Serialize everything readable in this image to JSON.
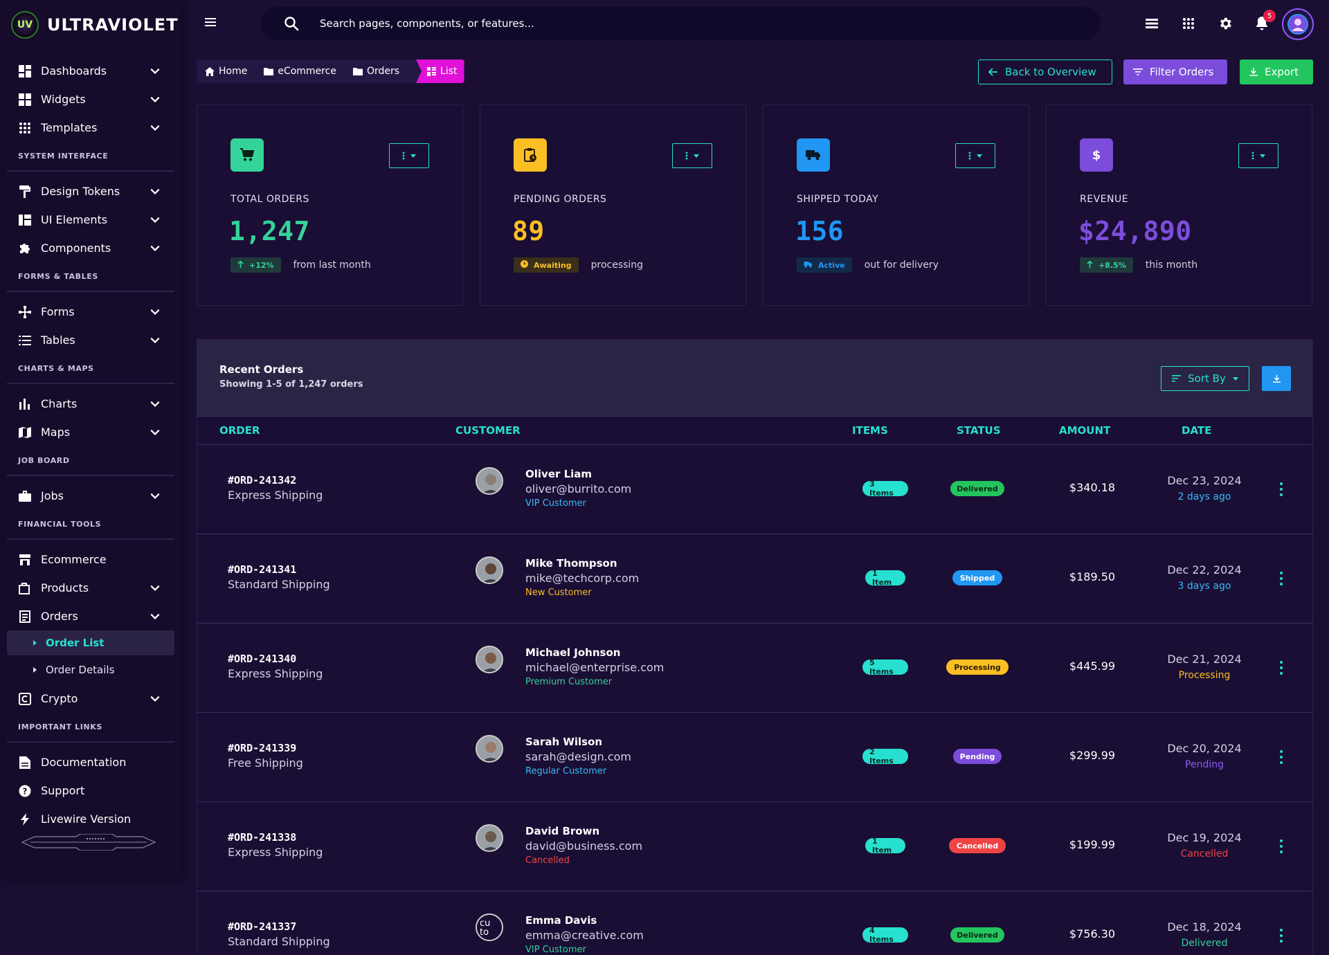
{
  "brand": {
    "logo_text": "UV",
    "name": "ULTRAVIOLET"
  },
  "sidebar": {
    "groups": [
      {
        "items": [
          {
            "label": "Dashboards",
            "icon": "dashboard-icon",
            "has_chevron": true
          },
          {
            "label": "Widgets",
            "icon": "widgets-icon",
            "has_chevron": true
          },
          {
            "label": "Templates",
            "icon": "grid-dots-icon",
            "has_chevron": true
          }
        ]
      },
      {
        "section": "SYSTEM INTERFACE",
        "items": [
          {
            "label": "Design Tokens",
            "icon": "paint-roller-icon",
            "has_chevron": true
          },
          {
            "label": "UI Elements",
            "icon": "ui-elements-icon",
            "has_chevron": true
          },
          {
            "label": "Components",
            "icon": "puzzle-icon",
            "has_chevron": true
          }
        ]
      },
      {
        "section": "FORMS & TABLES",
        "items": [
          {
            "label": "Forms",
            "icon": "forms-icon",
            "has_chevron": true
          },
          {
            "label": "Tables",
            "icon": "tables-icon",
            "has_chevron": true
          }
        ]
      },
      {
        "section": "CHARTS & MAPS",
        "items": [
          {
            "label": "Charts",
            "icon": "bar-chart-icon",
            "has_chevron": true
          },
          {
            "label": "Maps",
            "icon": "map-icon",
            "has_chevron": true
          }
        ]
      },
      {
        "section": "JOB BOARD",
        "items": [
          {
            "label": "Jobs",
            "icon": "briefcase-icon",
            "has_chevron": true
          }
        ]
      },
      {
        "section": "FINANCIAL TOOLS",
        "items": [
          {
            "label": "Ecommerce",
            "icon": "store-icon",
            "has_chevron": false
          },
          {
            "label": "Products",
            "icon": "products-icon",
            "has_chevron": true
          },
          {
            "label": "Orders",
            "icon": "orders-icon",
            "has_chevron": true,
            "children": [
              {
                "label": "Order List",
                "active": true
              },
              {
                "label": "Order Details",
                "active": false
              }
            ]
          },
          {
            "label": "Crypto",
            "icon": "crypto-icon",
            "has_chevron": true
          }
        ]
      },
      {
        "section": "IMPORTANT LINKS",
        "items": [
          {
            "label": "Documentation",
            "icon": "document-icon",
            "has_chevron": false
          },
          {
            "label": "Support",
            "icon": "help-icon",
            "has_chevron": false
          },
          {
            "label": "Livewire Version",
            "icon": "bolt-icon",
            "has_chevron": false
          }
        ]
      }
    ]
  },
  "topbar": {
    "search_placeholder": "Search pages, components, or features...",
    "notification_count": "5"
  },
  "breadcrumb": [
    {
      "label": "Home",
      "icon": "home-icon"
    },
    {
      "label": "eCommerce",
      "icon": "folder-icon"
    },
    {
      "label": "Orders",
      "icon": "folder-icon"
    },
    {
      "label": "List",
      "icon": "list-icon",
      "current": true
    }
  ],
  "header_buttons": {
    "back": "Back to Overview",
    "filter": "Filter Orders",
    "export": "Export"
  },
  "stats": [
    {
      "label": "TOTAL ORDERS",
      "value": "1,247",
      "badge": "+12%",
      "badge_icon": "arrow-up-icon",
      "note": "from last month",
      "color": "#34d399",
      "icon": "cart-icon",
      "icon_bg": "#34d399"
    },
    {
      "label": "PENDING ORDERS",
      "value": "89",
      "badge": "Awaiting",
      "badge_icon": "clock-icon",
      "note": "processing",
      "color": "#fbbf24",
      "icon": "clipboard-clock-icon",
      "icon_bg": "#fbbf24"
    },
    {
      "label": "SHIPPED TODAY",
      "value": "156",
      "badge": "Active",
      "badge_icon": "truck-icon",
      "note": "out for delivery",
      "color": "#2196f3",
      "icon": "truck-icon",
      "icon_bg": "#2196f3"
    },
    {
      "label": "REVENUE",
      "value": "$24,890",
      "badge": "+8.5%",
      "badge_icon": "arrow-up-icon",
      "note": "this month",
      "color": "#7c4ddb",
      "icon": "dollar-icon",
      "icon_bg": "#7c4ddb"
    }
  ],
  "orders": {
    "title": "Recent Orders",
    "subtitle": "Showing 1-5 of 1,247 orders",
    "sort_label": "Sort By",
    "columns": [
      "ORDER",
      "CUSTOMER",
      "ITEMS",
      "STATUS",
      "AMOUNT",
      "DATE"
    ],
    "rows": [
      {
        "id": "#ORD-241342",
        "shipping": "Express Shipping",
        "name": "Oliver Liam",
        "email": "oliver@burrito.com",
        "type": "VIP Customer",
        "type_color": "#38bdf8",
        "items": "3 Items",
        "status": "Delivered",
        "status_bg": "#22c55e",
        "status_fg": "#0b2a16",
        "amount": "$340.18",
        "date": "Dec 23, 2024",
        "rel": "2 days ago",
        "rel_color": "#38bdf8",
        "skin": "#8a7f78"
      },
      {
        "id": "#ORD-241341",
        "shipping": "Standard Shipping",
        "name": "Mike Thompson",
        "email": "mike@techcorp.com",
        "type": "New Customer",
        "type_color": "#fbbf24",
        "items": "1 Item",
        "status": "Shipped",
        "status_bg": "#2196f3",
        "status_fg": "#ffffff",
        "amount": "$189.50",
        "date": "Dec 22, 2024",
        "rel": "3 days ago",
        "rel_color": "#38bdf8",
        "skin": "#5e4534"
      },
      {
        "id": "#ORD-241340",
        "shipping": "Express Shipping",
        "name": "Michael Johnson",
        "email": "michael@enterprise.com",
        "type": "Premium Customer",
        "type_color": "#34d399",
        "items": "5 Items",
        "status": "Processing",
        "status_bg": "#fbbf24",
        "status_fg": "#2a1d00",
        "amount": "$445.99",
        "date": "Dec 21, 2024",
        "rel": "Processing",
        "rel_color": "#fbbf24",
        "skin": "#7a5a44"
      },
      {
        "id": "#ORD-241339",
        "shipping": "Free Shipping",
        "name": "Sarah Wilson",
        "email": "sarah@design.com",
        "type": "Regular Customer",
        "type_color": "#38bdf8",
        "items": "2 Items",
        "status": "Pending",
        "status_bg": "#7c4ddb",
        "status_fg": "#ffffff",
        "amount": "$299.99",
        "date": "Dec 20, 2024",
        "rel": "Pending",
        "rel_color": "#8b5cf6",
        "skin": "#9a7b68"
      },
      {
        "id": "#ORD-241338",
        "shipping": "Express Shipping",
        "name": "David Brown",
        "email": "david@business.com",
        "type": "Cancelled",
        "type_color": "#ef4444",
        "items": "1 Item",
        "status": "Cancelled",
        "status_bg": "#ef4444",
        "status_fg": "#ffffff",
        "amount": "$199.99",
        "date": "Dec 19, 2024",
        "rel": "Cancelled",
        "rel_color": "#ef4444",
        "skin": "#6a5a4e"
      },
      {
        "id": "#ORD-241337",
        "shipping": "Standard Shipping",
        "name": "Emma Davis",
        "email": "emma@creative.com",
        "type": "VIP Customer",
        "type_color": "#34d399",
        "items": "4 Items",
        "status": "Delivered",
        "status_bg": "#22c55e",
        "status_fg": "#0b2a16",
        "amount": "$756.30",
        "date": "Dec 18, 2024",
        "rel": "Delivered",
        "rel_color": "#34d399",
        "skin": "broken",
        "avatar_alt": "cu to"
      }
    ]
  },
  "colors": {
    "accent": "#27e0d0",
    "bg": "#1a0f33",
    "sidebar_bg": "#160b2b"
  }
}
